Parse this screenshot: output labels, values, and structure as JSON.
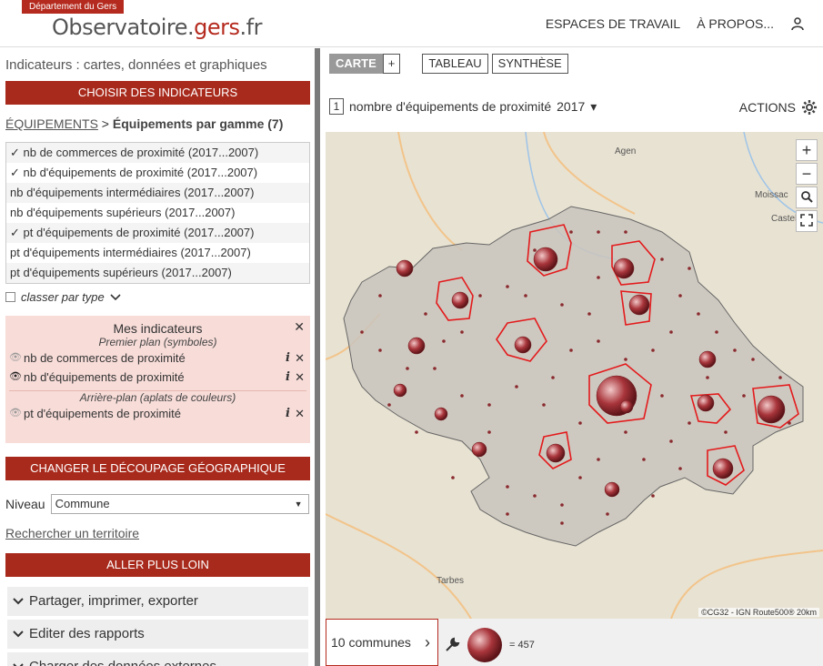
{
  "header": {
    "dept": "Département du Gers",
    "logo_main": "Observatoire.",
    "logo_accent": "gers",
    "logo_tail": ".fr",
    "nav": [
      "ESPACES DE TRAVAIL",
      "À PROPOS..."
    ]
  },
  "sidebar": {
    "title": "Indicateurs : cartes, données et graphiques",
    "choose_btn": "CHOISIR DES INDICATEURS",
    "breadcrumb_link": "ÉQUIPEMENTS",
    "breadcrumb_sep": ">",
    "breadcrumb_current": "Équipements par gamme (7)",
    "indicators": [
      "✓ nb de commerces de proximité (2017...2007)",
      "✓ nb d'équipements de proximité (2017...2007)",
      "nb d'équipements intermédiaires (2017...2007)",
      "nb d'équipements supérieurs (2017...2007)",
      "✓ pt d'équipements de proximité (2017...2007)",
      "pt d'équipements intermédiaires (2017...2007)",
      "pt d'équipements supérieurs (2017...2007)"
    ],
    "classer": "classer par type",
    "mes_title": "Mes indicateurs",
    "premier_plan": "Premier plan (symboles)",
    "premier_items": [
      "nb de commerces de proximité",
      "nb d'équipements de proximité"
    ],
    "arriere_plan": "Arrière-plan (aplats de couleurs)",
    "arriere_items": [
      "pt d'équipements de proximité"
    ],
    "change_btn": "CHANGER LE DÉCOUPAGE GÉOGRAPHIQUE",
    "niveau_label": "Niveau",
    "niveau_value": "Commune",
    "recherche": "Rechercher un territoire",
    "further_btn": "ALLER PLUS LOIN",
    "accordions": [
      "Partager, imprimer, exporter",
      "Editer des rapports",
      "Charger des données externes"
    ]
  },
  "main": {
    "tabs": [
      "CARTE",
      "+",
      "TABLEAU",
      "SYNTHÈSE"
    ],
    "ind_num": "1",
    "ind_label": "nombre d'équipements de proximité",
    "year": "2017",
    "actions": "ACTIONS",
    "map_labels": [
      "Agen",
      "Moissac",
      "Castelsarra",
      "Tarbes"
    ],
    "attribution": "©CG32 - IGN Route500®  20km",
    "communes": "10 communes",
    "legend_value": "= 457"
  },
  "colors": {
    "brand": "#a82a1c",
    "bubble": "#9e2f35",
    "highlight": "#e31a1c"
  }
}
